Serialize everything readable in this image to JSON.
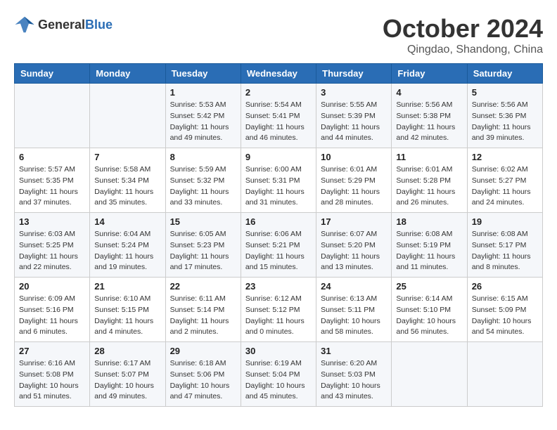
{
  "header": {
    "logo_general": "General",
    "logo_blue": "Blue",
    "month": "October 2024",
    "location": "Qingdao, Shandong, China"
  },
  "weekdays": [
    "Sunday",
    "Monday",
    "Tuesday",
    "Wednesday",
    "Thursday",
    "Friday",
    "Saturday"
  ],
  "weeks": [
    [
      {
        "day": "",
        "info": ""
      },
      {
        "day": "",
        "info": ""
      },
      {
        "day": "1",
        "info": "Sunrise: 5:53 AM\nSunset: 5:42 PM\nDaylight: 11 hours and 49 minutes."
      },
      {
        "day": "2",
        "info": "Sunrise: 5:54 AM\nSunset: 5:41 PM\nDaylight: 11 hours and 46 minutes."
      },
      {
        "day": "3",
        "info": "Sunrise: 5:55 AM\nSunset: 5:39 PM\nDaylight: 11 hours and 44 minutes."
      },
      {
        "day": "4",
        "info": "Sunrise: 5:56 AM\nSunset: 5:38 PM\nDaylight: 11 hours and 42 minutes."
      },
      {
        "day": "5",
        "info": "Sunrise: 5:56 AM\nSunset: 5:36 PM\nDaylight: 11 hours and 39 minutes."
      }
    ],
    [
      {
        "day": "6",
        "info": "Sunrise: 5:57 AM\nSunset: 5:35 PM\nDaylight: 11 hours and 37 minutes."
      },
      {
        "day": "7",
        "info": "Sunrise: 5:58 AM\nSunset: 5:34 PM\nDaylight: 11 hours and 35 minutes."
      },
      {
        "day": "8",
        "info": "Sunrise: 5:59 AM\nSunset: 5:32 PM\nDaylight: 11 hours and 33 minutes."
      },
      {
        "day": "9",
        "info": "Sunrise: 6:00 AM\nSunset: 5:31 PM\nDaylight: 11 hours and 31 minutes."
      },
      {
        "day": "10",
        "info": "Sunrise: 6:01 AM\nSunset: 5:29 PM\nDaylight: 11 hours and 28 minutes."
      },
      {
        "day": "11",
        "info": "Sunrise: 6:01 AM\nSunset: 5:28 PM\nDaylight: 11 hours and 26 minutes."
      },
      {
        "day": "12",
        "info": "Sunrise: 6:02 AM\nSunset: 5:27 PM\nDaylight: 11 hours and 24 minutes."
      }
    ],
    [
      {
        "day": "13",
        "info": "Sunrise: 6:03 AM\nSunset: 5:25 PM\nDaylight: 11 hours and 22 minutes."
      },
      {
        "day": "14",
        "info": "Sunrise: 6:04 AM\nSunset: 5:24 PM\nDaylight: 11 hours and 19 minutes."
      },
      {
        "day": "15",
        "info": "Sunrise: 6:05 AM\nSunset: 5:23 PM\nDaylight: 11 hours and 17 minutes."
      },
      {
        "day": "16",
        "info": "Sunrise: 6:06 AM\nSunset: 5:21 PM\nDaylight: 11 hours and 15 minutes."
      },
      {
        "day": "17",
        "info": "Sunrise: 6:07 AM\nSunset: 5:20 PM\nDaylight: 11 hours and 13 minutes."
      },
      {
        "day": "18",
        "info": "Sunrise: 6:08 AM\nSunset: 5:19 PM\nDaylight: 11 hours and 11 minutes."
      },
      {
        "day": "19",
        "info": "Sunrise: 6:08 AM\nSunset: 5:17 PM\nDaylight: 11 hours and 8 minutes."
      }
    ],
    [
      {
        "day": "20",
        "info": "Sunrise: 6:09 AM\nSunset: 5:16 PM\nDaylight: 11 hours and 6 minutes."
      },
      {
        "day": "21",
        "info": "Sunrise: 6:10 AM\nSunset: 5:15 PM\nDaylight: 11 hours and 4 minutes."
      },
      {
        "day": "22",
        "info": "Sunrise: 6:11 AM\nSunset: 5:14 PM\nDaylight: 11 hours and 2 minutes."
      },
      {
        "day": "23",
        "info": "Sunrise: 6:12 AM\nSunset: 5:12 PM\nDaylight: 11 hours and 0 minutes."
      },
      {
        "day": "24",
        "info": "Sunrise: 6:13 AM\nSunset: 5:11 PM\nDaylight: 10 hours and 58 minutes."
      },
      {
        "day": "25",
        "info": "Sunrise: 6:14 AM\nSunset: 5:10 PM\nDaylight: 10 hours and 56 minutes."
      },
      {
        "day": "26",
        "info": "Sunrise: 6:15 AM\nSunset: 5:09 PM\nDaylight: 10 hours and 54 minutes."
      }
    ],
    [
      {
        "day": "27",
        "info": "Sunrise: 6:16 AM\nSunset: 5:08 PM\nDaylight: 10 hours and 51 minutes."
      },
      {
        "day": "28",
        "info": "Sunrise: 6:17 AM\nSunset: 5:07 PM\nDaylight: 10 hours and 49 minutes."
      },
      {
        "day": "29",
        "info": "Sunrise: 6:18 AM\nSunset: 5:06 PM\nDaylight: 10 hours and 47 minutes."
      },
      {
        "day": "30",
        "info": "Sunrise: 6:19 AM\nSunset: 5:04 PM\nDaylight: 10 hours and 45 minutes."
      },
      {
        "day": "31",
        "info": "Sunrise: 6:20 AM\nSunset: 5:03 PM\nDaylight: 10 hours and 43 minutes."
      },
      {
        "day": "",
        "info": ""
      },
      {
        "day": "",
        "info": ""
      }
    ]
  ]
}
